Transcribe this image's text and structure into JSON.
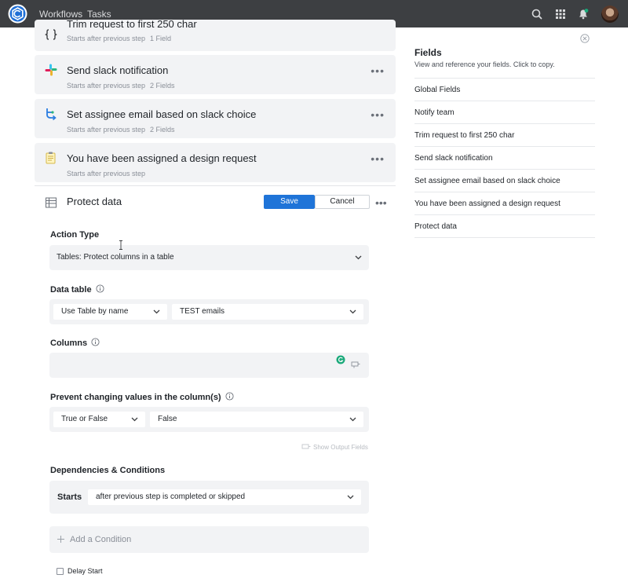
{
  "topbar": {
    "nav": [
      "Workflows",
      "Tasks"
    ],
    "icons": [
      "search-icon",
      "apps-grid-icon",
      "notification-bell-icon"
    ],
    "background": "#3d3f42"
  },
  "steps": [
    {
      "title": "Trim request to first 250 char",
      "subtitle": "Starts after previous step",
      "fields": "1 Field",
      "icon": "code-braces-icon"
    },
    {
      "title": "Send slack notification",
      "subtitle": "Starts after previous step",
      "fields": "2 Fields",
      "icon": "slack-icon"
    },
    {
      "title": "Set assignee email based on slack choice",
      "subtitle": "Starts after previous step",
      "fields": "2 Fields",
      "icon": "branch-icon"
    },
    {
      "title": "You have been assigned a design request",
      "subtitle": "Starts after previous step",
      "fields": "",
      "icon": "notepad-icon"
    }
  ],
  "expanded": {
    "title": "Protect data",
    "save_label": "Save",
    "cancel_label": "Cancel",
    "action_type_label": "Action Type",
    "action_type_value": "Tables: Protect columns in a table",
    "data_table_label": "Data table",
    "data_table_mode": "Use Table by name",
    "data_table_value": "TEST emails",
    "columns_label": "Columns",
    "columns_value": "",
    "prevent_label": "Prevent changing values in the column(s)",
    "prevent_type": "True or False",
    "prevent_value": "False",
    "show_output_label": "Show Output Fields",
    "dependencies_label": "Dependencies & Conditions",
    "starts_label": "Starts",
    "starts_value": "after previous step is completed or skipped",
    "add_condition_label": "Add a Condition",
    "delay_start_label": "Delay Start"
  },
  "fields_panel": {
    "title": "Fields",
    "description": "View and reference your fields. Click to copy.",
    "items": [
      "Global Fields",
      "Notify team",
      "Trim request to first 250 char",
      "Send slack notification",
      "Set assignee email based on slack choice",
      "You have been assigned a design request",
      "Protect data"
    ]
  },
  "colors": {
    "primary": "#1f74d8",
    "card": "#f2f3f5",
    "accent_green": "#1aa97a"
  }
}
